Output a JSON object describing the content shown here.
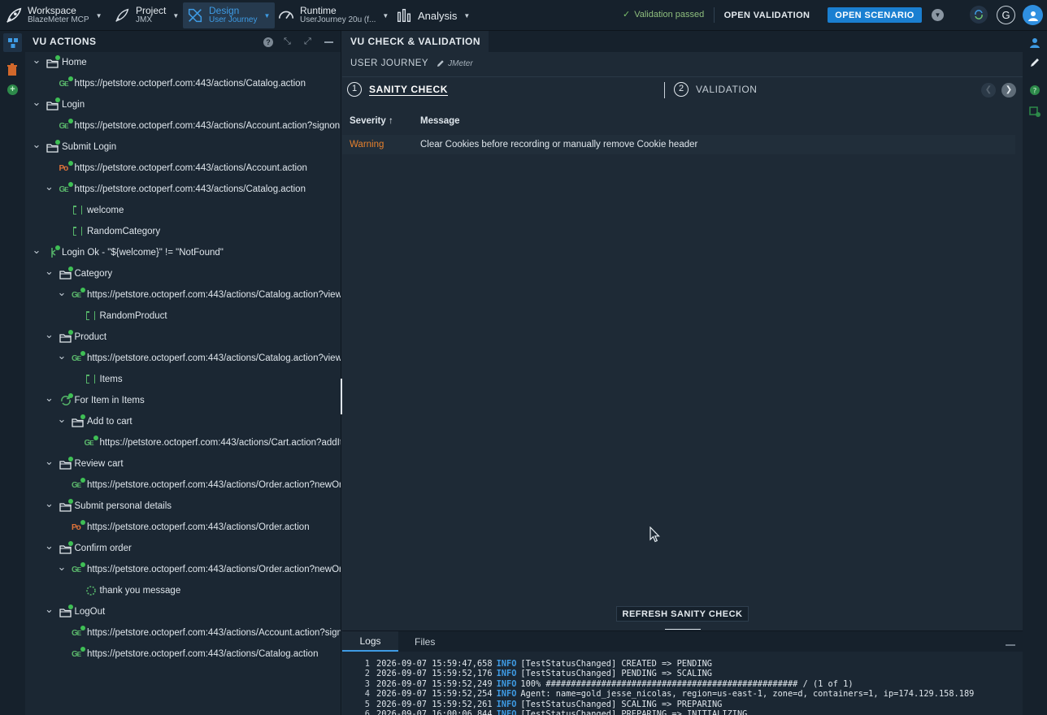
{
  "topbar": {
    "workspace": {
      "label": "Workspace",
      "value": "BlazeMeter MCP"
    },
    "project": {
      "label": "Project",
      "value": "JMX"
    },
    "design": {
      "label": "Design",
      "value": "User Journey"
    },
    "runtime": {
      "label": "Runtime",
      "value": "UserJourney 20u (f..."
    },
    "analysis": {
      "label": "Analysis"
    },
    "validation_status": "Validation passed",
    "open_validation": "OPEN VALIDATION",
    "open_scenario": "OPEN SCENARIO",
    "google_letter": "G"
  },
  "vu_panel": {
    "title": "VU ACTIONS",
    "help": "?",
    "tree": [
      {
        "label": "Home",
        "icon": "folder-icon"
      },
      {
        "label": "https://petstore.octoperf.com:443/actions/Catalog.action",
        "icon": "get-request-icon"
      },
      {
        "label": "Login",
        "icon": "folder-icon"
      },
      {
        "label": "https://petstore.octoperf.com:443/actions/Account.action?signonF",
        "icon": "get-request-icon"
      },
      {
        "label": "Submit Login",
        "icon": "folder-icon"
      },
      {
        "label": "https://petstore.octoperf.com:443/actions/Account.action",
        "icon": "post-request-icon"
      },
      {
        "label": "https://petstore.octoperf.com:443/actions/Catalog.action",
        "icon": "get-request-icon"
      },
      {
        "label": "welcome",
        "icon": "extractor-icon"
      },
      {
        "label": "RandomCategory",
        "icon": "extractor-icon"
      },
      {
        "label": "Login Ok - \"${welcome}\" != \"NotFound\"",
        "icon": "if-condition-icon"
      },
      {
        "label": "Category",
        "icon": "folder-icon"
      },
      {
        "label": "https://petstore.octoperf.com:443/actions/Catalog.action?viewC",
        "icon": "get-request-icon"
      },
      {
        "label": "RandomProduct",
        "icon": "extractor-icon"
      },
      {
        "label": "Product",
        "icon": "folder-icon"
      },
      {
        "label": "https://petstore.octoperf.com:443/actions/Catalog.action?viewP",
        "icon": "get-request-icon"
      },
      {
        "label": "Items",
        "icon": "extractor-icon"
      },
      {
        "label": "For Item in Items",
        "icon": "loop-icon"
      },
      {
        "label": "Add to cart",
        "icon": "folder-icon"
      },
      {
        "label": "https://petstore.octoperf.com:443/actions/Cart.action?addIte",
        "icon": "get-request-icon"
      },
      {
        "label": "Review cart",
        "icon": "folder-icon"
      },
      {
        "label": "https://petstore.octoperf.com:443/actions/Order.action?newOrd",
        "icon": "get-request-icon"
      },
      {
        "label": "Submit personal details",
        "icon": "folder-icon"
      },
      {
        "label": "https://petstore.octoperf.com:443/actions/Order.action",
        "icon": "post-request-icon"
      },
      {
        "label": "Confirm order",
        "icon": "folder-icon"
      },
      {
        "label": "https://petstore.octoperf.com:443/actions/Order.action?newOrd",
        "icon": "get-request-icon"
      },
      {
        "label": "thank you message",
        "icon": "assertion-icon"
      },
      {
        "label": "LogOut",
        "icon": "folder-icon"
      },
      {
        "label": "https://petstore.octoperf.com:443/actions/Account.action?signo",
        "icon": "get-request-icon"
      },
      {
        "label": "https://petstore.octoperf.com:443/actions/Catalog.action",
        "icon": "get-request-icon"
      }
    ]
  },
  "main": {
    "tab": "VU CHECK & VALIDATION",
    "journey_title": "USER JOURNEY",
    "journey_tag": "JMeter",
    "steps": [
      {
        "num": "1",
        "label": "SANITY CHECK"
      },
      {
        "num": "2",
        "label": "VALIDATION"
      }
    ],
    "table": {
      "headers": {
        "severity": "Severity ↑",
        "message": "Message"
      },
      "rows": [
        {
          "severity": "Warning",
          "message": "Clear Cookies before recording or manually remove Cookie header"
        }
      ]
    },
    "refresh_button": "REFRESH SANITY CHECK"
  },
  "logs": {
    "tabs": [
      "Logs",
      "Files"
    ],
    "lines": [
      {
        "n": "1",
        "ts": "2026-09-07 15:59:47,658",
        "level": "INFO",
        "msg": "[TestStatusChanged] CREATED => PENDING"
      },
      {
        "n": "2",
        "ts": "2026-09-07 15:59:52,176",
        "level": "INFO",
        "msg": "[TestStatusChanged] PENDING => SCALING"
      },
      {
        "n": "3",
        "ts": "2026-09-07 15:59:52,249",
        "level": "INFO",
        "msg": "100% ################################################## / (1 of 1)"
      },
      {
        "n": "4",
        "ts": "2026-09-07 15:59:52,254",
        "level": "INFO",
        "msg": "Agent: name=gold_jesse_nicolas, region=us-east-1, zone=d, containers=1, ip=174.129.158.189"
      },
      {
        "n": "5",
        "ts": "2026-09-07 15:59:52,261",
        "level": "INFO",
        "msg": "[TestStatusChanged] SCALING => PREPARING"
      },
      {
        "n": "6",
        "ts": "2026-09-07 16:00:06,844",
        "level": "INFO",
        "msg": "[TestStatusChanged] PREPARING => INITIALIZING"
      }
    ]
  },
  "colors": {
    "accent": "#1a7fd1",
    "warning": "#e6812e",
    "ok": "#3fbf55"
  }
}
